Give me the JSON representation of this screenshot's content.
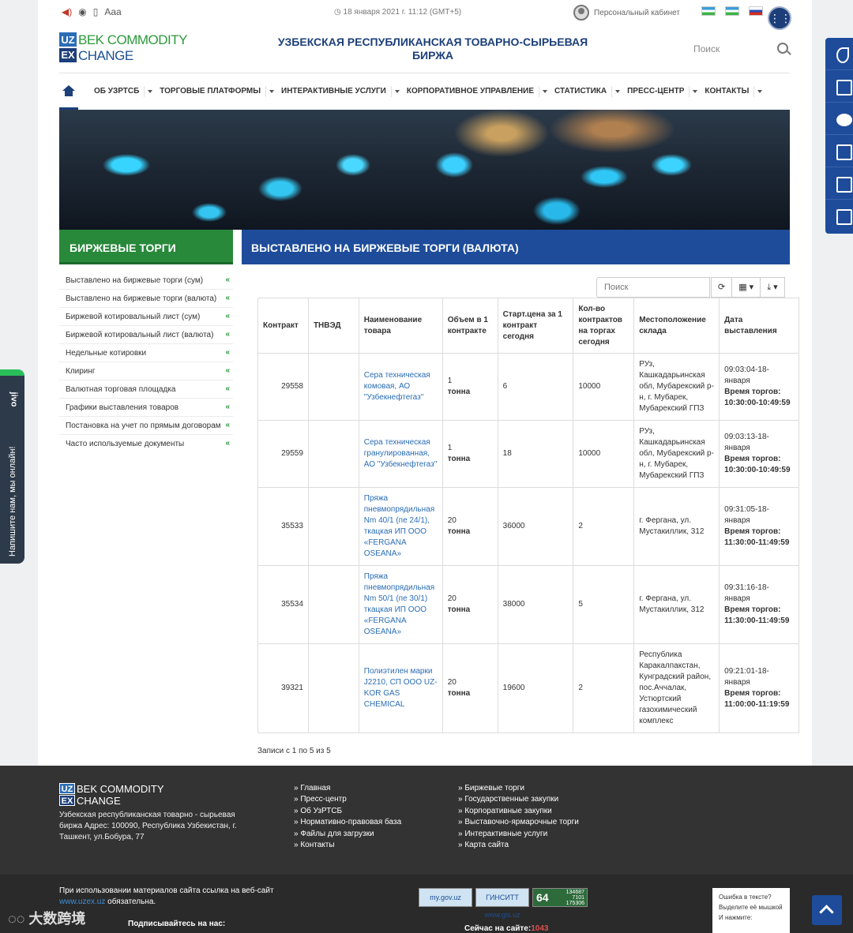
{
  "topbar": {
    "font_size_label": "Aaa",
    "datetime": "18 января 2021 г. 11:12 (GMT+5)",
    "cabinet_label": "Персональный кабинет"
  },
  "header": {
    "logo_box1": "UZ",
    "logo_box2": "EX",
    "logo_line1": "BEK COMMODITY",
    "logo_line2": "CHANGE",
    "title": "УЗБЕКСКАЯ РЕСПУБЛИКАНСКАЯ ТОВАРНО-СЫРЬЕВАЯ БИРЖА",
    "search_label": "Поиск"
  },
  "nav": {
    "items": [
      "ОБ УЗРТСБ",
      "ТОРГОВЫЕ ПЛАТФОРМЫ",
      "ИНТЕРАКТИВНЫЕ УСЛУГИ",
      "КОРПОРАТИВНОЕ УПРАВЛЕНИЕ",
      "СТАТИСТИКА",
      "ПРЕСС-ЦЕНТР",
      "КОНТАКТЫ"
    ]
  },
  "sections": {
    "left_title": "БИРЖЕВЫЕ ТОРГИ",
    "main_title": "ВЫСТАВЛЕНО НА БИРЖЕВЫЕ ТОРГИ (ВАЛЮТА)"
  },
  "side_menu": [
    "Выставлено на биржевые торги (сум)",
    "Выставлено на биржевые торги (валюта)",
    "Биржевой котировальный лист (сум)",
    "Биржевой котировальный лист (валюта)",
    "Недельные котировки",
    "Клиринг",
    "Валютная торговая площадка",
    "Графики выставления товаров",
    "Постановка на учет по прямым договорам",
    "Часто используемые документы"
  ],
  "table_tools": {
    "search_placeholder": "Поиск",
    "refresh_icon": "refresh-icon",
    "columns_icon": "columns-icon",
    "export_icon": "export-icon"
  },
  "table": {
    "headers": [
      "Контракт",
      "ТНВЭД",
      "Наименование товара",
      "Объем в 1 контракте",
      "Старт.цена за 1 контракт сегодня",
      "Кол-во контрактов на торгах сегодня",
      "Местоположение склада",
      "Дата выставления"
    ],
    "time_label": "Время торгов:",
    "rows": [
      {
        "contract": "29558",
        "tnved": "",
        "name": "Сера техническая комовая, АО \"Узбекнефтегаз\"",
        "vol_num": "1",
        "vol_unit": "тонна",
        "price": "6",
        "qty": "10000",
        "location": "РУз, Кашкадарьинская обл, Мубарекский р-н, г. Мубарек, Мубарекский ГПЗ",
        "date": "09:03:04-18-января",
        "time": "10:30:00-10:49:59"
      },
      {
        "contract": "29559",
        "tnved": "",
        "name": "Сера техническая гранулированная, АО \"Узбекнефтегаз\"",
        "vol_num": "1",
        "vol_unit": "тонна",
        "price": "18",
        "qty": "10000",
        "location": "РУз, Кашкадарьинская обл, Мубарекский р-н, г. Мубарек, Мубарекский ГПЗ",
        "date": "09:03:13-18-января",
        "time": "10:30:00-10:49:59"
      },
      {
        "contract": "35533",
        "tnved": "",
        "name": "Пряжа пневмопрядильная Nm 40/1 (пе 24/1), ткацкая ИП ООО «FERGANA OSEANA»",
        "vol_num": "20",
        "vol_unit": "тонна",
        "price": "36000",
        "qty": "2",
        "location": "г. Фергана, ул. Мустакиллик, 312",
        "date": "09:31:05-18-января",
        "time": "11:30:00-11:49:59"
      },
      {
        "contract": "35534",
        "tnved": "",
        "name": "Пряжа пневмопрядильная Nm 50/1 (пе 30/1) ткацкая ИП ООО «FERGANA OSEANA»",
        "vol_num": "20",
        "vol_unit": "тонна",
        "price": "38000",
        "qty": "5",
        "location": "г. Фергана, ул. Мустакиллик, 312",
        "date": "09:31:16-18-января",
        "time": "11:30:00-11:49:59"
      },
      {
        "contract": "39321",
        "tnved": "",
        "name": "Полиэтилен марки J2210, СП ООО UZ-KOR GAS CHEMICAL",
        "vol_num": "20",
        "vol_unit": "тонна",
        "price": "19600",
        "qty": "2",
        "location": "Республика Каракалпакстан, Кунградский район, пос.Аччалак, Устюртский газохимический комплекс",
        "date": "09:21:01-18-января",
        "time": "11:00:00-11:19:59"
      }
    ],
    "records_info": "Записи с 1 по 5 из 5"
  },
  "jivo": {
    "logo": "jivo",
    "text": "Напишите нам, мы онлайн!"
  },
  "footer": {
    "logo_box1": "UZ",
    "logo_box2": "EX",
    "logo_line1": "BEK COMMODITY",
    "logo_line2": "CHANGE",
    "address": "Узбекская республиканская товарно - сырьевая биржа Адрес: 100090, Республика Узбекистан, г. Ташкент, ул.Бобура, 77",
    "col1": [
      "Главная",
      "Пресс-центр",
      "Об УзРТСБ",
      "Нормативно-правовая база",
      "Файлы для загрузки",
      "Контакты"
    ],
    "col2": [
      "Биржевые торги",
      "Государственные закупки",
      "Корпоративные закупки",
      "Выставочно-ярмарочные торги",
      "Интерактивные услуги",
      "Карта сайта"
    ],
    "note_pre": "При использовании материалов сайта ссылка на веб-сайт",
    "note_link": "www.uzex.uz",
    "note_post": "обязательна.",
    "subscribe": "Подписывайтесь на нас:",
    "badge1": "my.gov.uz",
    "badge2": "ГИНСИТТ www.gis.uz",
    "counter_main": "64",
    "counter_a": "134687",
    "counter_b": "7101",
    "counter_c": "175306",
    "online_label": "Сейчас на сайте:",
    "online_count": "1043",
    "error_line1": "Ошибка в тексте?",
    "error_line2": "Выделите её мышкой",
    "error_line3": "И нажмите:",
    "watermark": "大数跨境"
  }
}
